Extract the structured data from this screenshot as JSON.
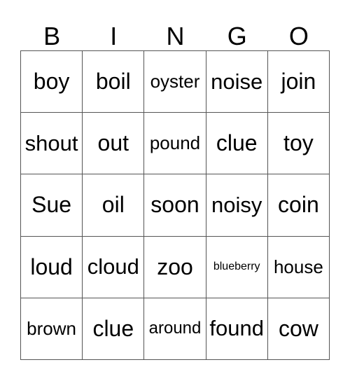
{
  "header": [
    "B",
    "I",
    "N",
    "G",
    "O"
  ],
  "cells": [
    [
      "boy",
      "boil",
      "oyster",
      "noise",
      "join"
    ],
    [
      "shout",
      "out",
      "pound",
      "clue",
      "toy"
    ],
    [
      "Sue",
      "oil",
      "soon",
      "noisy",
      "coin"
    ],
    [
      "loud",
      "cloud",
      "zoo",
      "blueberry",
      "house"
    ],
    [
      "brown",
      "clue",
      "around",
      "found",
      "cow"
    ]
  ]
}
